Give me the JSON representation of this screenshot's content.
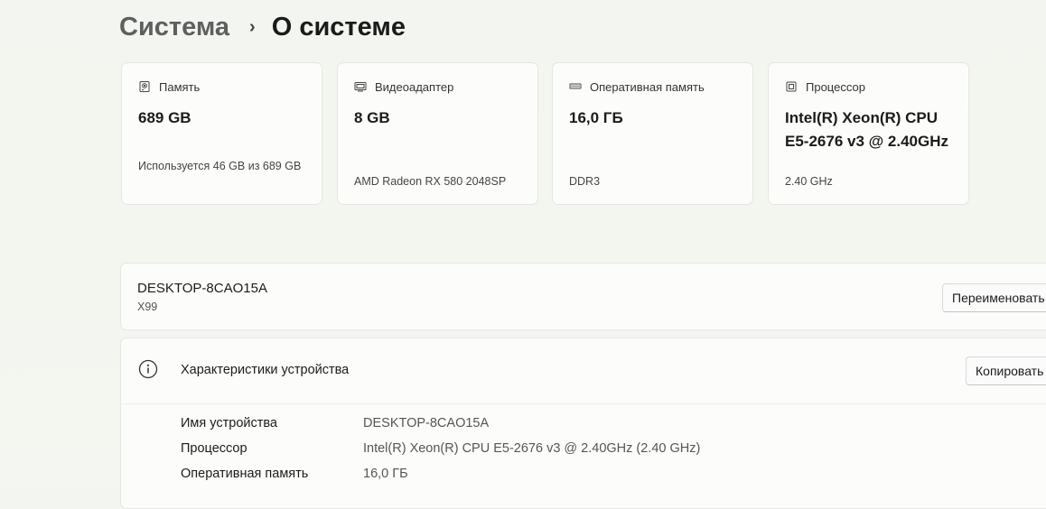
{
  "breadcrumb": {
    "parent": "Система",
    "separator": "›",
    "current": "О системе"
  },
  "cards": [
    {
      "icon": "storage-icon",
      "label": "Память",
      "value": "689 GB",
      "sub": "Используется 46 GB из 689 GB"
    },
    {
      "icon": "display-adapter-icon",
      "label": "Видеоадаптер",
      "value": "8 GB",
      "sub": "AMD Radeon RX 580 2048SP"
    },
    {
      "icon": "ram-icon",
      "label": "Оперативная память",
      "value": "16,0 ГБ",
      "sub": "DDR3"
    },
    {
      "icon": "processor-icon",
      "label": "Процессор",
      "value": "Intel(R) Xeon(R) CPU E5-2676 v3 @ 2.40GHz",
      "sub": "2.40 GHz"
    }
  ],
  "device": {
    "name": "DESKTOP-8CAO15A",
    "model": "X99",
    "rename_label": "Переименовать"
  },
  "specs": {
    "title": "Характеристики устройства",
    "copy_label": "Копировать",
    "rows": [
      {
        "label": "Имя устройства",
        "value": "DESKTOP-8CAO15A"
      },
      {
        "label": "Процессор",
        "value": "Intel(R) Xeon(R) CPU E5-2676 v3 @ 2.40GHz (2.40 GHz)"
      },
      {
        "label": "Оперативная память",
        "value": "16,0 ГБ"
      }
    ]
  }
}
